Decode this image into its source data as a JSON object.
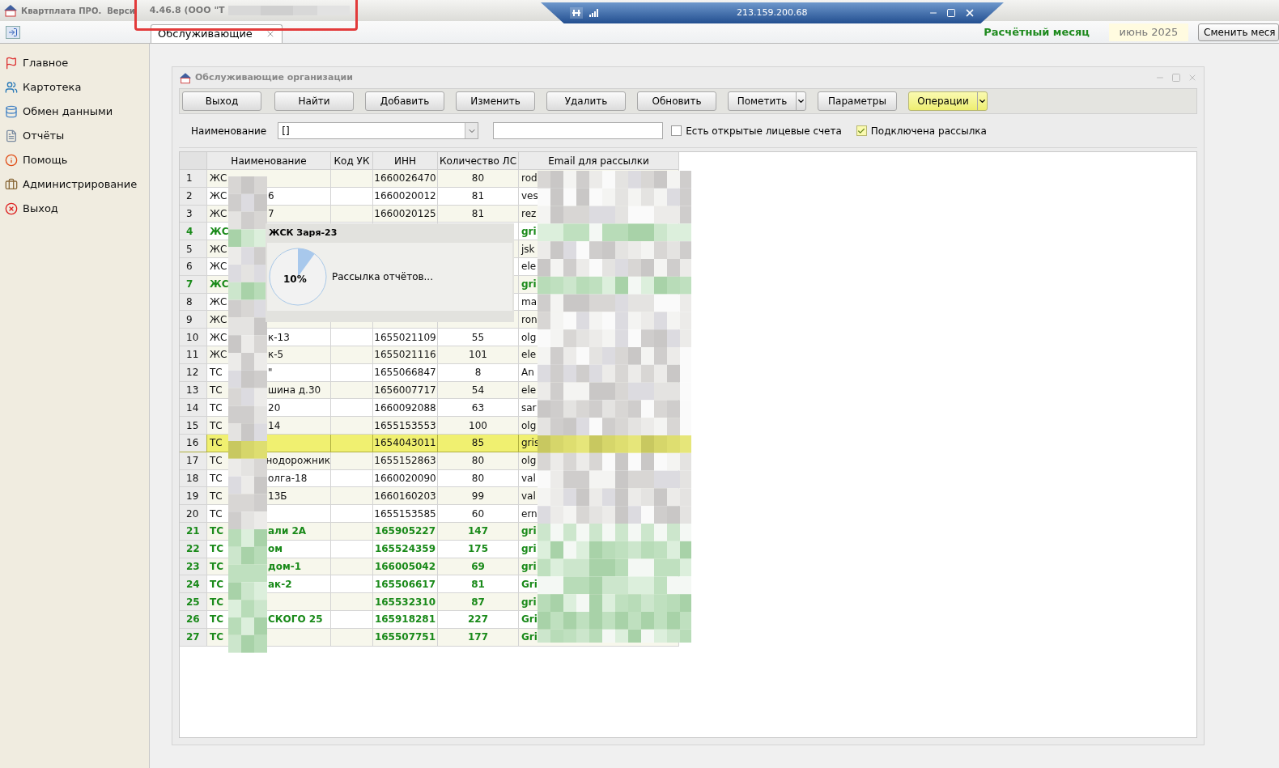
{
  "app_title": {
    "title": "Квартплата ПРО.  Верси",
    "version": "4.46.8 (ООО \"Т"
  },
  "remote_bar": {
    "address": "213.159.200.68"
  },
  "tabs": [
    {
      "label": "Обслуживающие",
      "selected": true
    }
  ],
  "period": {
    "label": "Расчётный месяц",
    "value": "июнь 2025",
    "button": "Сменить меся"
  },
  "sidebar": {
    "items": [
      {
        "label": "Главное"
      },
      {
        "label": "Картотека"
      },
      {
        "label": "Обмен данными"
      },
      {
        "label": "Отчёты"
      },
      {
        "label": "Помощь"
      },
      {
        "label": "Администрирование"
      },
      {
        "label": "Выход"
      }
    ]
  },
  "window": {
    "title": "Обслуживающие организации"
  },
  "toolbar": [
    {
      "label": "Выход",
      "kind": "plain",
      "highlighted": false
    },
    {
      "label": "Найти",
      "kind": "plain",
      "highlighted": false
    },
    {
      "label": "Добавить",
      "kind": "plain",
      "highlighted": false
    },
    {
      "label": "Изменить",
      "kind": "plain",
      "highlighted": false
    },
    {
      "label": "Удалить",
      "kind": "plain",
      "highlighted": false
    },
    {
      "label": "Обновить",
      "kind": "plain",
      "highlighted": false
    },
    {
      "label": "Пометить",
      "kind": "split",
      "highlighted": false
    },
    {
      "label": "Параметры",
      "kind": "plain",
      "highlighted": false
    },
    {
      "label": "Операции",
      "kind": "split",
      "highlighted": true
    }
  ],
  "filter": {
    "label": "Наименование",
    "value": "[]",
    "checkboxes": [
      {
        "label": "Есть открытые лицевые счета",
        "checked": false
      },
      {
        "label": "Подключена рассылка",
        "checked": true
      }
    ]
  },
  "table": {
    "columns": [
      "Наименование",
      "Код УК",
      "ИНН",
      "Количество ЛС",
      "Email для рассылки"
    ],
    "rows": [
      {
        "number": "1",
        "name_start": "ЖС",
        "name_end": "",
        "inn": "1660026470",
        "count": "80",
        "email": "rod",
        "emphasized": false,
        "selected": false
      },
      {
        "number": "2",
        "name_start": "ЖС",
        "name_end": "6",
        "inn": "1660020012",
        "count": "81",
        "email": "ves",
        "emphasized": false,
        "selected": false
      },
      {
        "number": "3",
        "name_start": "ЖС",
        "name_end": "7",
        "inn": "1660020125",
        "count": "81",
        "email": "rez",
        "emphasized": false,
        "selected": false
      },
      {
        "number": "4",
        "name_start": "ЖС",
        "name_end": "",
        "inn": "",
        "count": "",
        "email": "gri",
        "emphasized": true,
        "selected": false
      },
      {
        "number": "5",
        "name_start": "ЖС",
        "name_end": "",
        "inn": "",
        "count": "",
        "email": "jsk",
        "emphasized": false,
        "selected": false
      },
      {
        "number": "6",
        "name_start": "ЖС",
        "name_end": "",
        "inn": "",
        "count": "",
        "email": "ele",
        "emphasized": false,
        "selected": false
      },
      {
        "number": "7",
        "name_start": "ЖС",
        "name_end": "",
        "inn": "",
        "count": "",
        "email": "gri",
        "emphasized": true,
        "selected": false
      },
      {
        "number": "8",
        "name_start": "ЖС",
        "name_end": "",
        "inn": "",
        "count": "",
        "email": "ma",
        "emphasized": false,
        "selected": false
      },
      {
        "number": "9",
        "name_start": "ЖС",
        "name_end": "",
        "inn": "",
        "count": "",
        "email": "ron",
        "emphasized": false,
        "selected": false
      },
      {
        "number": "10",
        "name_start": "ЖС",
        "name_end": "к-13",
        "inn": "1655021109",
        "count": "55",
        "email": "olg",
        "emphasized": false,
        "selected": false
      },
      {
        "number": "11",
        "name_start": "ЖС",
        "name_end": "к-5",
        "inn": "1655021116",
        "count": "101",
        "email": "ele",
        "emphasized": false,
        "selected": false
      },
      {
        "number": "12",
        "name_start": "ТС",
        "name_end": "\"",
        "inn": "1655066847",
        "count": "8",
        "email": "An",
        "emphasized": false,
        "selected": false
      },
      {
        "number": "13",
        "name_start": "ТС",
        "name_end": "шина д.30",
        "inn": "1656007717",
        "count": "54",
        "email": "ele",
        "emphasized": false,
        "selected": false
      },
      {
        "number": "14",
        "name_start": "ТС",
        "name_end": "20",
        "inn": "1660092088",
        "count": "63",
        "email": "sar",
        "emphasized": false,
        "selected": false
      },
      {
        "number": "15",
        "name_start": "ТС",
        "name_end": "14",
        "inn": "1655153553",
        "count": "100",
        "email": "olg",
        "emphasized": false,
        "selected": false
      },
      {
        "number": "16",
        "name_start": "ТС",
        "name_end": "",
        "inn": "1654043011",
        "count": "85",
        "email": "gris",
        "emphasized": false,
        "selected": true
      },
      {
        "number": "17",
        "name_start": "ТС",
        "name_end": "нодорожник",
        "inn": "1655152863",
        "count": "80",
        "email": "olg",
        "emphasized": false,
        "selected": false
      },
      {
        "number": "18",
        "name_start": "ТС",
        "name_end": "олга-18",
        "inn": "1660020090",
        "count": "80",
        "email": "val",
        "emphasized": false,
        "selected": false
      },
      {
        "number": "19",
        "name_start": "ТС",
        "name_end": "13Б",
        "inn": "1660160203",
        "count": "99",
        "email": "val",
        "emphasized": false,
        "selected": false
      },
      {
        "number": "20",
        "name_start": "ТС",
        "name_end": "",
        "inn": "1655153585",
        "count": "60",
        "email": "ern",
        "emphasized": false,
        "selected": false
      },
      {
        "number": "21",
        "name_start": "ТС",
        "name_end": "али 2А",
        "inn": "165905227",
        "count": "147",
        "email": "gri",
        "emphasized": true,
        "selected": false
      },
      {
        "number": "22",
        "name_start": "ТС",
        "name_end": "ом",
        "inn": "165524359",
        "count": "175",
        "email": "gri",
        "emphasized": true,
        "selected": false
      },
      {
        "number": "23",
        "name_start": "ТС",
        "name_end": "дом-1",
        "inn": "166005042",
        "count": "69",
        "email": "gri",
        "emphasized": true,
        "selected": false
      },
      {
        "number": "24",
        "name_start": "ТС",
        "name_end": "ак-2",
        "inn": "165506617",
        "count": "81",
        "email": "Gri",
        "emphasized": true,
        "selected": false
      },
      {
        "number": "25",
        "name_start": "ТС",
        "name_end": "",
        "inn": "165532310",
        "count": "87",
        "email": "gri",
        "emphasized": true,
        "selected": false
      },
      {
        "number": "26",
        "name_start": "ТС",
        "name_end": "СКОГО 25",
        "inn": "165918281",
        "count": "227",
        "email": "Gri",
        "emphasized": true,
        "selected": false
      },
      {
        "number": "27",
        "name_start": "ТС",
        "name_end": "",
        "inn": "165507751",
        "count": "177",
        "email": "Gri",
        "emphasized": true,
        "selected": false
      }
    ]
  },
  "progress_dialog": {
    "title": "ЖСК Заря-23",
    "percent": "10%",
    "level": 0.1,
    "message": "Рассылка отчётов..."
  }
}
